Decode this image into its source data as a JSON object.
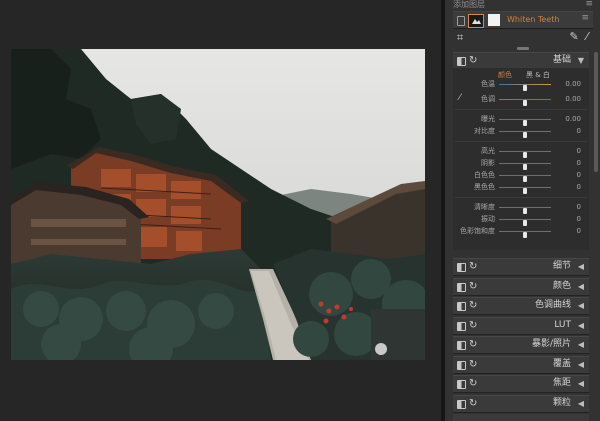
{
  "panel": {
    "layer_header": "添加图层",
    "menu_glyph": "≡",
    "layer": {
      "name": "Whiten Teeth"
    },
    "toolbar": {
      "crop_icon": "crop-icon",
      "tools": "✎ ⁄"
    }
  },
  "basic": {
    "title": "基础",
    "tabs": {
      "color": "颜色",
      "bw": "黑 & 白"
    },
    "sliders": [
      {
        "label": "色温",
        "value": "0.00",
        "pos": 0.5
      },
      {
        "label": "色调",
        "value": "0.00",
        "pos": 0.5
      },
      {
        "label": "曝光",
        "value": "0.00",
        "pos": 0.5
      },
      {
        "label": "对比度",
        "value": "0",
        "pos": 0.5
      },
      {
        "label": "高光",
        "value": "0",
        "pos": 0.5
      },
      {
        "label": "阴影",
        "value": "0",
        "pos": 0.5
      },
      {
        "label": "白色色",
        "value": "0",
        "pos": 0.5
      },
      {
        "label": "黑色色",
        "value": "0",
        "pos": 0.5
      },
      {
        "label": "清晰度",
        "value": "0",
        "pos": 0.5
      },
      {
        "label": "振动",
        "value": "0",
        "pos": 0.5
      },
      {
        "label": "色彩饱和度",
        "value": "0",
        "pos": 0.5
      }
    ]
  },
  "sections": [
    {
      "label": "细节"
    },
    {
      "label": "颜色"
    },
    {
      "label": "色调曲线"
    },
    {
      "label": "LUT"
    },
    {
      "label": "暴影/照片"
    },
    {
      "label": "覆盖"
    },
    {
      "label": "焦距"
    },
    {
      "label": "颗粒"
    }
  ],
  "colors": {
    "accent": "#d0813f",
    "panel": "#323232",
    "canvas": "#262626"
  }
}
